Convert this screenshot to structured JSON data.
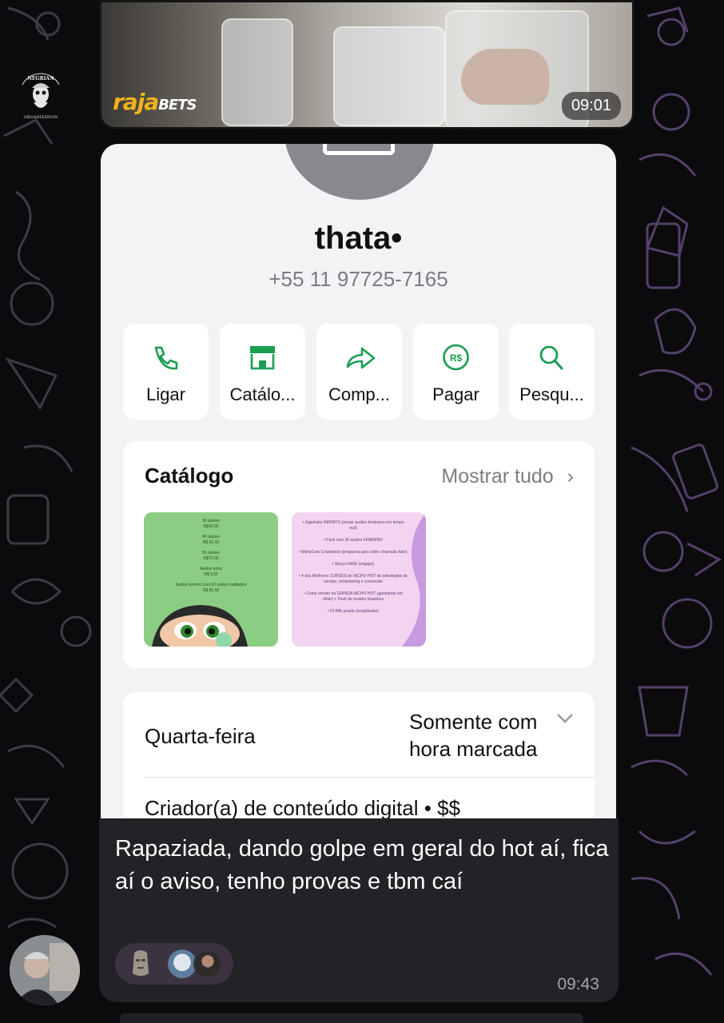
{
  "video_message": {
    "watermark_brand_1": "raja",
    "watermark_brand_2": "BETS",
    "time": "09:01"
  },
  "group_logo": {
    "text_top": "NEGRIAN",
    "text_bottom": "ORGANIZATION"
  },
  "contact_screenshot": {
    "name": "thata•",
    "phone": "+55 11 97725-7165",
    "actions": [
      {
        "label": "Ligar",
        "icon": "phone-icon"
      },
      {
        "label": "Catálo...",
        "icon": "store-icon"
      },
      {
        "label": "Comp...",
        "icon": "share-arrow-icon"
      },
      {
        "label": "Pagar",
        "icon": "pix-real-icon"
      },
      {
        "label": "Pesqu...",
        "icon": "search-icon"
      }
    ],
    "catalog": {
      "title": "Catálogo",
      "show_all": "Mostrar tudo",
      "item1_lines": [
        "30 áudios",
        "R$40,00",
        "40 áudios",
        "R$ 60,00",
        "50 áudios",
        "R$70,00",
        "Áudios extra",
        "R$ 5,00",
        "Sorteio premio com 60 áudios validados",
        "R$ 80,00"
      ],
      "item2_lines": [
        "• Zapshake INFINITO (enviar áudios femininos em tempo real)",
        "• Pack com 30 áudios FEMININO",
        "• ManyCam Crackeado (programa para vídeo chamada fake)",
        "• Storys FAKE (engajar)",
        "• 4 dos Melhores CURSOS do NICHO HOT de estratégias de vendas, remarketing e conversão",
        "• Como vender na GRINGA NICHO HOT (ganhando em dólar) + Pack de modelo brasileira",
        "• PLIME pronto (script/áudio)"
      ]
    },
    "hours": {
      "day": "Quarta-feira",
      "line1": "Somente com",
      "line2": "hora marcada"
    },
    "category": "Criador(a) de conteúdo digital • $$"
  },
  "caption": {
    "text": "Rapaziada, dando golpe em geral do hot aí, fica aí o aviso, tenho provas e tbm caí",
    "time": "09:43",
    "reactions": [
      "moai-emoji",
      "avatar-reactor-1",
      "avatar-reactor-2"
    ]
  },
  "colors": {
    "whatsapp_green": "#1a9e52",
    "chat_background": "#0b0a0d",
    "bubble": "#232227"
  }
}
